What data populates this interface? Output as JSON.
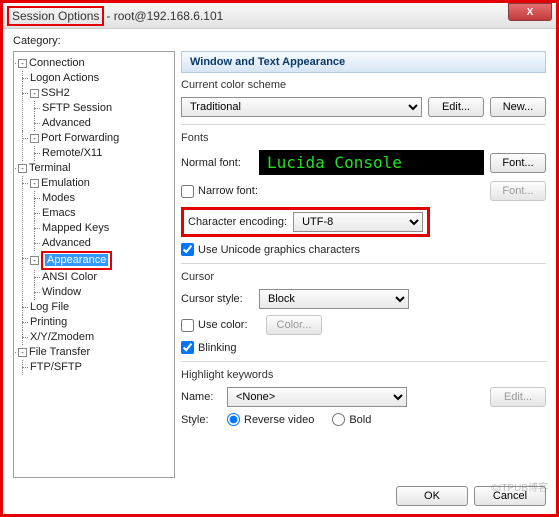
{
  "title": {
    "framed": "Session Options",
    "rest": "- root@192.168.6.101"
  },
  "close_x": "X",
  "category_label": "Category:",
  "tree": {
    "connection": "Connection",
    "logon": "Logon Actions",
    "ssh2": "SSH2",
    "sftp": "SFTP Session",
    "advanced1": "Advanced",
    "portfwd": "Port Forwarding",
    "remotex": "Remote/X11",
    "terminal": "Terminal",
    "emulation": "Emulation",
    "modes": "Modes",
    "emacs": "Emacs",
    "mapped": "Mapped Keys",
    "advanced2": "Advanced",
    "appearance": "Appearance",
    "ansi": "ANSI Color",
    "window": "Window",
    "logfile": "Log File",
    "printing": "Printing",
    "xyzmodem": "X/Y/Zmodem",
    "filetransfer": "File Transfer",
    "ftpsftp": "FTP/SFTP"
  },
  "panel": {
    "header": "Window and Text Appearance",
    "scheme_label": "Current color scheme",
    "scheme_value": "Traditional",
    "edit_btn": "Edit...",
    "new_btn": "New...",
    "fonts_label": "Fonts",
    "normal_font_label": "Normal font:",
    "font_preview": "Lucida Console",
    "font_btn": "Font...",
    "narrow_chk": "Narrow font:",
    "font_btn2": "Font...",
    "encoding_label": "Character encoding:",
    "encoding_value": "UTF-8",
    "unicode_chk": "Use Unicode graphics characters",
    "cursor_label": "Cursor",
    "cursor_style_label": "Cursor style:",
    "cursor_style_value": "Block",
    "use_color_chk": "Use color:",
    "color_btn": "Color...",
    "blinking_chk": "Blinking",
    "hk_label": "Highlight keywords",
    "name_label": "Name:",
    "name_value": "<None>",
    "style_label": "Style:",
    "rv": "Reverse video",
    "bold": "Bold",
    "hk_edit_btn": "Edit..."
  },
  "footer": {
    "ok": "OK",
    "cancel": "Cancel"
  },
  "watermark": "©ITPUB博客"
}
